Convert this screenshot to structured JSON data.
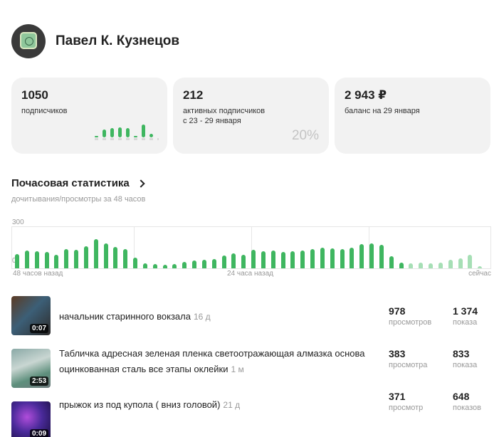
{
  "profile": {
    "name": "Павел К. Кузнецов"
  },
  "cards": [
    {
      "value": "1050",
      "label": "подписчиков"
    },
    {
      "value": "212",
      "label": "активных подписчиков",
      "sub": "с 23 - 29 января",
      "percent": "20%"
    },
    {
      "value": "2 943 ₽",
      "label": "баланс на 29 января"
    }
  ],
  "hourly": {
    "title": "Почасовая статистика",
    "subtitle": "дочитывания/просмотры за 48 часов",
    "y_max_label": "300",
    "y_zero_label": "0",
    "x_start_label": "48 часов назад",
    "x_mid_label": "24 часа назад",
    "x_end_label": "сейчас"
  },
  "chart_data": {
    "type": "bar",
    "ylim": [
      0,
      300
    ],
    "values": [
      105,
      130,
      125,
      120,
      100,
      140,
      135,
      160,
      210,
      180,
      155,
      140,
      80,
      35,
      30,
      25,
      30,
      45,
      55,
      60,
      65,
      95,
      110,
      100,
      135,
      125,
      130,
      120,
      125,
      130,
      140,
      150,
      145,
      140,
      150,
      175,
      180,
      170,
      90,
      40,
      35,
      40,
      35,
      40,
      60,
      75,
      100,
      15
    ],
    "colors": [
      "#3fb660",
      "#a6dfb5"
    ],
    "grid": true
  },
  "mini_chart": {
    "values": [
      5,
      30,
      35,
      40,
      35,
      5,
      50,
      15
    ],
    "color": "#3fb660"
  },
  "videos": [
    {
      "title": "начальник старинного вокзала",
      "age": "16 д",
      "duration": "0:07",
      "views": "978",
      "views_label": "просмотров",
      "shows": "1 374",
      "shows_label": "показа"
    },
    {
      "title": "Табличка адресная зеленая пленка светоотражающая алмазка основа оцинкованная сталь все этапы оклейки",
      "age": "1 м",
      "duration": "2:53",
      "views": "383",
      "views_label": "просмотра",
      "shows": "833",
      "shows_label": "показа"
    },
    {
      "title": "прыжок из под купола ( вниз головой)",
      "age": "21 д",
      "duration": "0:09",
      "views": "371",
      "views_label": "просмотр",
      "shows": "648",
      "shows_label": "показов"
    }
  ]
}
